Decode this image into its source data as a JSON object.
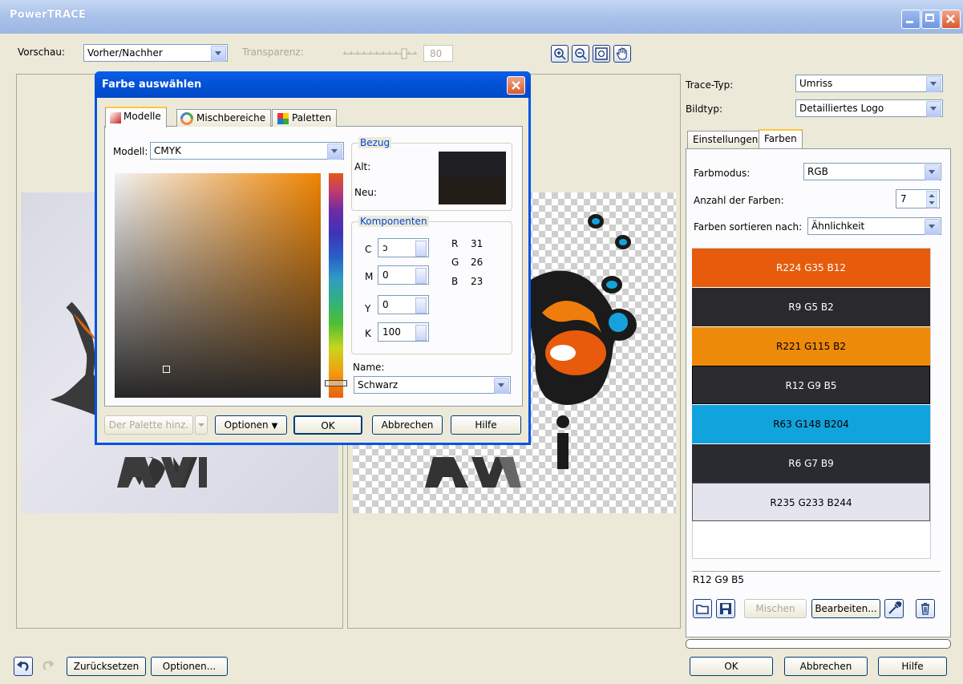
{
  "window": {
    "title": "PowerTRACE"
  },
  "toolbar": {
    "preview_label": "Vorschau:",
    "preview_value": "Vorher/Nachher",
    "transparency_label": "Transparenz:",
    "transparency_value": "80"
  },
  "right": {
    "trace_type_label": "Trace-Typ:",
    "trace_type_value": "Umriss",
    "image_type_label": "Bildtyp:",
    "image_type_value": "Detailliertes Logo",
    "tabs": [
      "Einstellungen",
      "Farben"
    ],
    "color_mode_label": "Farbmodus:",
    "color_mode_value": "RGB",
    "num_colors_label": "Anzahl der Farben:",
    "num_colors_value": "7",
    "sort_label": "Farben sortieren nach:",
    "sort_value": "Ähnlichkeit",
    "swatches": [
      {
        "label": "R224 G35 B12",
        "color": "#e65c0c",
        "text": "#ffffff"
      },
      {
        "label": "R9 G5 B2",
        "color": "#2a2a2e",
        "text": "#ffffff"
      },
      {
        "label": "R221 G115 B2",
        "color": "#ee8a0a",
        "text": "#000000"
      },
      {
        "label": "R12 G9 B5",
        "color": "#2b2b30",
        "text": "#ffffff"
      },
      {
        "label": "R63 G148 B204",
        "color": "#11a3dc",
        "text": "#000000"
      },
      {
        "label": "R6 G7 B9",
        "color": "#2a2b30",
        "text": "#ffffff"
      },
      {
        "label": "R235 G233 B244",
        "color": "#e4e4ee",
        "text": "#000000"
      }
    ],
    "selected_color": "R12 G9 B5",
    "mix_button": "Mischen",
    "edit_button": "Bearbeiten...",
    "ok_button": "OK",
    "cancel_button": "Abbrechen",
    "help_button": "Hilfe"
  },
  "bottom": {
    "reset_button": "Zurücksetzen",
    "options_button": "Optionen..."
  },
  "dialog": {
    "title": "Farbe auswählen",
    "tabs": [
      "Modelle",
      "Mischbereiche",
      "Paletten"
    ],
    "model_label": "Modell:",
    "model_value": "CMYK",
    "reference_label": "Bezug",
    "old_label": "Alt:",
    "new_label": "Neu:",
    "old_color": "#1f1f23",
    "new_color": "#231d17",
    "components_label": "Komponenten",
    "c_label": "C",
    "c_value": "ↄ",
    "m_label": "M",
    "m_value": "0",
    "y_label": "Y",
    "y_value": "0",
    "k_label": "K",
    "k_value": "100",
    "r_label": "R",
    "r_value": "31",
    "g_label": "G",
    "g_value": "26",
    "b_label": "B",
    "b_value": "23",
    "name_label": "Name:",
    "name_value": "Schwarz",
    "add_palette_button": "Der Palette hinz.",
    "options_button": "Optionen",
    "ok_button": "OK",
    "cancel_button": "Abbrechen",
    "help_button": "Hilfe"
  }
}
